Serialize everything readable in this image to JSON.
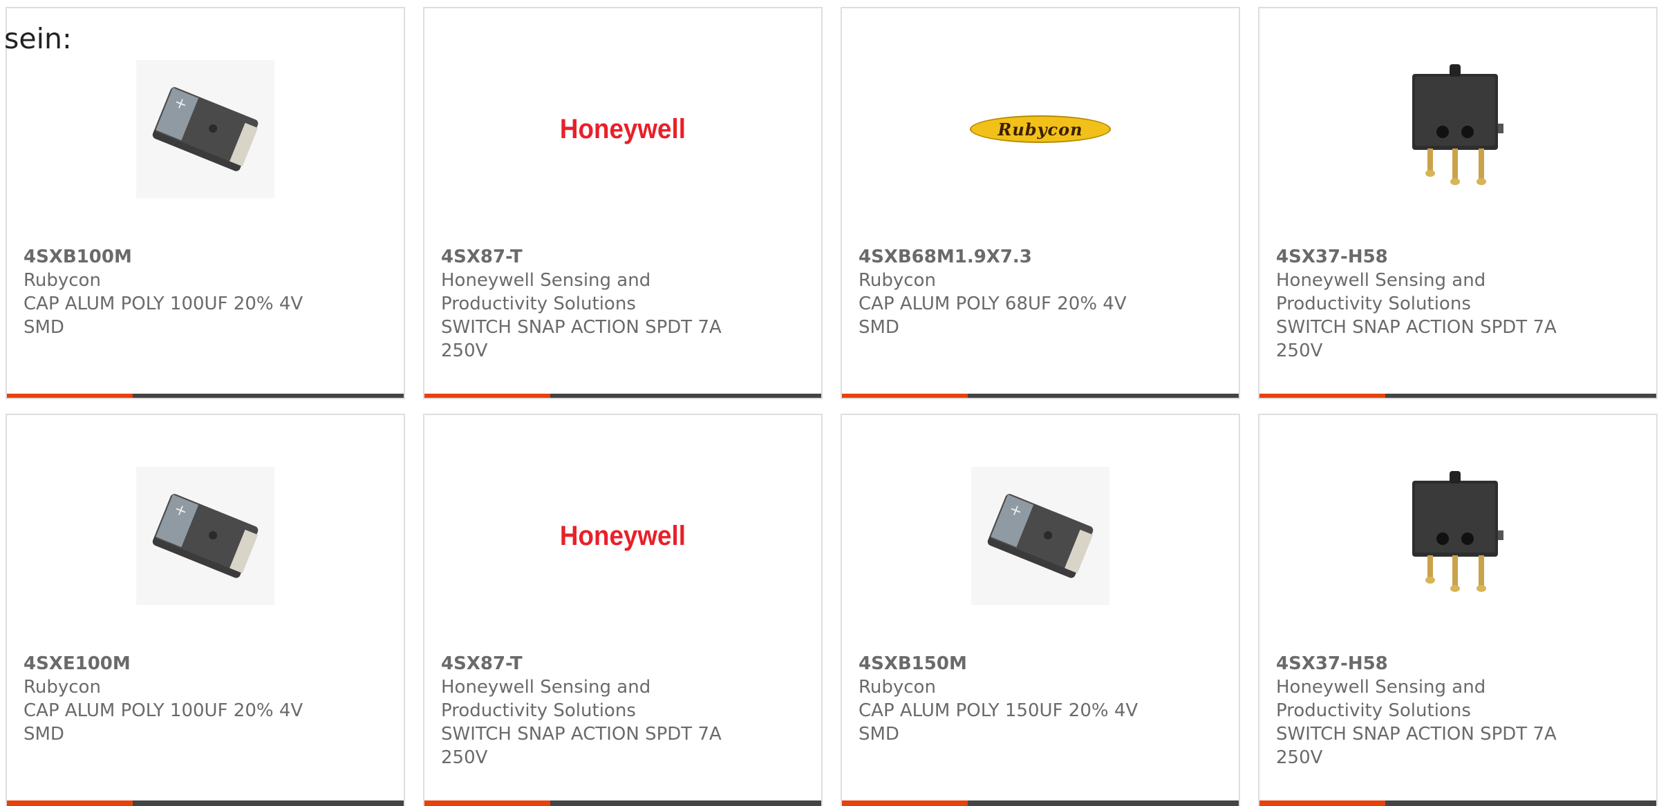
{
  "intro_text": "sein:",
  "colors": {
    "accent": "#e8410b",
    "bar": "#444444",
    "text": "#6a6a6a",
    "honeywell_red": "#e8202a",
    "rubycon_yellow": "#f2c119"
  },
  "products": [
    {
      "part_number": "4SXB100M",
      "manufacturer": "Rubycon",
      "desc_line1": "CAP ALUM POLY 100UF 20% 4V",
      "desc_line2": "SMD",
      "image": "capacitor-photo"
    },
    {
      "part_number": "4SX87-T",
      "manufacturer_line1": "Honeywell Sensing and",
      "manufacturer_line2": "Productivity Solutions",
      "desc_line1": "SWITCH SNAP ACTION SPDT 7A",
      "desc_line2": "250V",
      "image": "honeywell-logo",
      "logo_text": "Honeywell"
    },
    {
      "part_number": "4SXB68M1.9X7.3",
      "manufacturer": "Rubycon",
      "desc_line1": "CAP ALUM POLY 68UF 20% 4V",
      "desc_line2": "SMD",
      "image": "rubycon-logo",
      "logo_text": "Rubycon"
    },
    {
      "part_number": "4SX37-H58",
      "manufacturer_line1": "Honeywell Sensing and",
      "manufacturer_line2": "Productivity Solutions",
      "desc_line1": "SWITCH SNAP ACTION SPDT 7A",
      "desc_line2": "250V",
      "image": "snap-switch-photo"
    },
    {
      "part_number": "4SXE100M",
      "manufacturer": "Rubycon",
      "desc_line1": "CAP ALUM POLY 100UF 20% 4V",
      "desc_line2": "SMD",
      "image": "capacitor-photo"
    },
    {
      "part_number": "4SX87-T",
      "manufacturer_line1": "Honeywell Sensing and",
      "manufacturer_line2": "Productivity Solutions",
      "desc_line1": "SWITCH SNAP ACTION SPDT 7A",
      "desc_line2": "250V",
      "image": "honeywell-logo",
      "logo_text": "Honeywell"
    },
    {
      "part_number": "4SXB150M",
      "manufacturer": "Rubycon",
      "desc_line1": "CAP ALUM POLY 150UF 20% 4V",
      "desc_line2": "SMD",
      "image": "capacitor-photo"
    },
    {
      "part_number": "4SX37-H58",
      "manufacturer_line1": "Honeywell Sensing and",
      "manufacturer_line2": "Productivity Solutions",
      "desc_line1": "SWITCH SNAP ACTION SPDT 7A",
      "desc_line2": "250V",
      "image": "snap-switch-photo"
    }
  ]
}
